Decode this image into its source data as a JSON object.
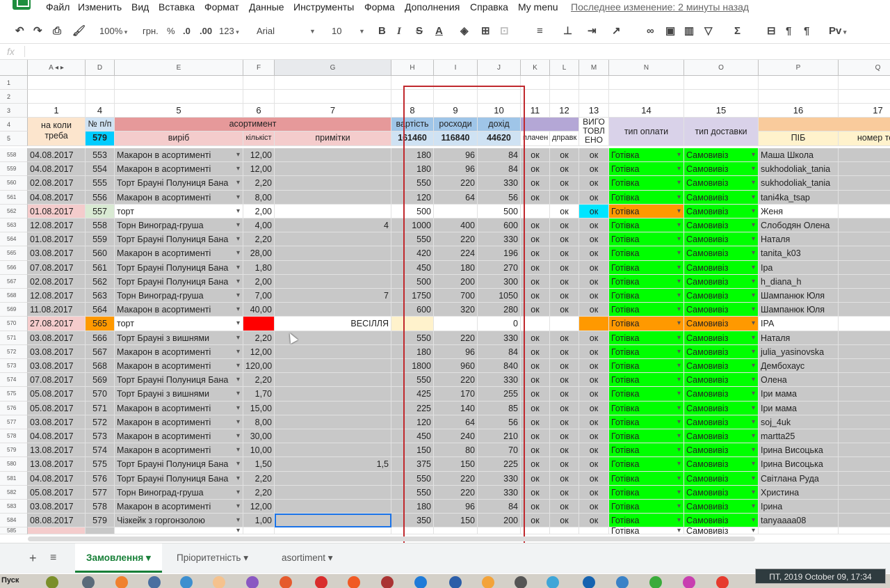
{
  "menu": {
    "items": [
      "Файл",
      "Изменить",
      "Вид",
      "Вставка",
      "Формат",
      "Данные",
      "Инструменты",
      "Форма",
      "Дополнения",
      "Справка",
      "My menu"
    ],
    "last_edit": "Последнее изменение: 2 минуты назад"
  },
  "toolbar": {
    "zoom": "100%",
    "currency": "грн.",
    "percent": "%",
    "dec_less": ".0",
    "dec_more": ".00",
    "format": "123",
    "font": "Arial",
    "size": "10",
    "bold": "B",
    "italic": "I",
    "strike": "S",
    "textcolor": "A",
    "fx": "fx",
    "cyr": "Рv"
  },
  "columns": [
    {
      "id": "A",
      "w": 83
    },
    {
      "id": "D",
      "w": 42
    },
    {
      "id": "E",
      "w": 185
    },
    {
      "id": "F",
      "w": 45
    },
    {
      "id": "G",
      "w": 168
    },
    {
      "id": "H",
      "w": 61
    },
    {
      "id": "I",
      "w": 63
    },
    {
      "id": "J",
      "w": 62
    },
    {
      "id": "K",
      "w": 42
    },
    {
      "id": "L",
      "w": 42
    },
    {
      "id": "M",
      "w": 43
    },
    {
      "id": "N",
      "w": 108
    },
    {
      "id": "O",
      "w": 107
    },
    {
      "id": "P",
      "w": 115
    },
    {
      "id": "Q",
      "w": 114
    }
  ],
  "row_numbers": [
    "1",
    "4",
    "5",
    "6",
    "7",
    "8",
    "9",
    "10",
    "11",
    "12",
    "13",
    "14",
    "15",
    "16",
    "17"
  ],
  "header4": {
    "a": "на коли",
    "a2": "треба",
    "d": "№ п/п",
    "assort": "асортимент",
    "h": "вартість",
    "i": "росходи",
    "j": "дохід",
    "m": "ВИГО",
    "m2": "ТОВЛ",
    "m3": "ЕНО",
    "n": "тип оплати",
    "o": "тип доставки"
  },
  "header5": {
    "d": "579",
    "e": "виріб",
    "f": "кількіст",
    "g": "примітки",
    "h": "161460",
    "i": "116840",
    "j": "44620",
    "k": "плачен",
    "l": "дправк",
    "p": "ПІБ",
    "q": "номер тел"
  },
  "rows": [
    {
      "n": "558",
      "a": "04.08.2017",
      "d": "553",
      "e": "Макарон в асортименті",
      "f": "12,00",
      "g": "",
      "h": "180",
      "i": "96",
      "j": "84",
      "k": "ок",
      "l": "ок",
      "m": "ок",
      "pay": "Готівка",
      "del": "Самовивіз",
      "p": "Маша Школа"
    },
    {
      "n": "559",
      "a": "04.08.2017",
      "d": "554",
      "e": "Макарон в асортименті",
      "f": "12,00",
      "g": "",
      "h": "180",
      "i": "96",
      "j": "84",
      "k": "ок",
      "l": "ок",
      "m": "ок",
      "pay": "Готівка",
      "del": "Самовивіз",
      "p": "sukhodoliak_tania"
    },
    {
      "n": "560",
      "a": "02.08.2017",
      "d": "555",
      "e": "Торт Брауні Полуниця Бана",
      "f": "2,20",
      "g": "",
      "h": "550",
      "i": "220",
      "j": "330",
      "k": "ок",
      "l": "ок",
      "m": "ок",
      "pay": "Готівка",
      "del": "Самовивіз",
      "p": "sukhodoliak_tania"
    },
    {
      "n": "561",
      "a": "04.08.2017",
      "d": "556",
      "e": "Макарон в асортименті",
      "f": "8,00",
      "g": "",
      "h": "120",
      "i": "64",
      "j": "56",
      "k": "ок",
      "l": "ок",
      "m": "ок",
      "pay": "Готівка",
      "del": "Самовивіз",
      "p": "tani4ka_tsap"
    },
    {
      "n": "562",
      "a": "01.08.2017",
      "d": "557",
      "e": "торт",
      "f": "2,00",
      "g": "",
      "h": "500",
      "i": "",
      "j": "500",
      "k": "",
      "l": "ок",
      "m": "ок",
      "pay": "Готівка",
      "del": "Самовивіз",
      "p": "Женя",
      "special": "pink"
    },
    {
      "n": "563",
      "a": "12.08.2017",
      "d": "558",
      "e": "Торн Виноград-груша",
      "f": "4,00",
      "g": "4",
      "h": "1000",
      "i": "400",
      "j": "600",
      "k": "ок",
      "l": "ок",
      "m": "ок",
      "pay": "Готівка",
      "del": "Самовивіз",
      "p": "Слободян Олена"
    },
    {
      "n": "564",
      "a": "01.08.2017",
      "d": "559",
      "e": "Торт Брауні Полуниця Бана",
      "f": "2,20",
      "g": "",
      "h": "550",
      "i": "220",
      "j": "330",
      "k": "ок",
      "l": "ок",
      "m": "ок",
      "pay": "Готівка",
      "del": "Самовивіз",
      "p": "Наталя"
    },
    {
      "n": "565",
      "a": "03.08.2017",
      "d": "560",
      "e": "Макарон в асортименті",
      "f": "28,00",
      "g": "",
      "h": "420",
      "i": "224",
      "j": "196",
      "k": "ок",
      "l": "ок",
      "m": "ок",
      "pay": "Готівка",
      "del": "Самовивіз",
      "p": "tanita_k03"
    },
    {
      "n": "566",
      "a": "07.08.2017",
      "d": "561",
      "e": "Торт Брауні Полуниця Бана",
      "f": "1,80",
      "g": "",
      "h": "450",
      "i": "180",
      "j": "270",
      "k": "ок",
      "l": "ок",
      "m": "ок",
      "pay": "Готівка",
      "del": "Самовивіз",
      "p": "Іра"
    },
    {
      "n": "567",
      "a": "02.08.2017",
      "d": "562",
      "e": "Торт Брауні Полуниця Бана",
      "f": "2,00",
      "g": "",
      "h": "500",
      "i": "200",
      "j": "300",
      "k": "ок",
      "l": "ок",
      "m": "ок",
      "pay": "Готівка",
      "del": "Самовивіз",
      "p": "h_diana_h"
    },
    {
      "n": "568",
      "a": "12.08.2017",
      "d": "563",
      "e": "Торн Виноград-груша",
      "f": "7,00",
      "g": "7",
      "h": "1750",
      "i": "700",
      "j": "1050",
      "k": "ок",
      "l": "ок",
      "m": "ок",
      "pay": "Готівка",
      "del": "Самовивіз",
      "p": "Шампанюк Юля"
    },
    {
      "n": "569",
      "a": "11.08.2017",
      "d": "564",
      "e": "Макарон в асортименті",
      "f": "40,00",
      "g": "",
      "h": "600",
      "i": "320",
      "j": "280",
      "k": "ок",
      "l": "ок",
      "m": "ок",
      "pay": "Готівка",
      "del": "Самовивіз",
      "p": "Шампанюк Юля"
    },
    {
      "n": "570",
      "a": "27.08.2017",
      "d": "565",
      "e": "торт",
      "f": "",
      "g": "ВЕСІЛЛЯ",
      "h": "",
      "i": "",
      "j": "0",
      "k": "",
      "l": "",
      "m": "",
      "pay": "Готівка",
      "del": "Самовивіз",
      "p": "ІРА",
      "special": "orange"
    },
    {
      "n": "571",
      "a": "03.08.2017",
      "d": "566",
      "e": "Торт Брауні з вишнями",
      "f": "2,20",
      "g": "",
      "h": "550",
      "i": "220",
      "j": "330",
      "k": "ок",
      "l": "ок",
      "m": "ок",
      "pay": "Готівка",
      "del": "Самовивіз",
      "p": "Наталя"
    },
    {
      "n": "572",
      "a": "03.08.2017",
      "d": "567",
      "e": "Макарон в асортименті",
      "f": "12,00",
      "g": "",
      "h": "180",
      "i": "96",
      "j": "84",
      "k": "ок",
      "l": "ок",
      "m": "ок",
      "pay": "Готівка",
      "del": "Самовивіз",
      "p": "julia_yasinovska"
    },
    {
      "n": "573",
      "a": "03.08.2017",
      "d": "568",
      "e": "Макарон в асортименті",
      "f": "120,00",
      "g": "",
      "h": "1800",
      "i": "960",
      "j": "840",
      "k": "ок",
      "l": "ок",
      "m": "ок",
      "pay": "Готівка",
      "del": "Самовивіз",
      "p": "Дембохаус"
    },
    {
      "n": "574",
      "a": "07.08.2017",
      "d": "569",
      "e": "Торт Брауні Полуниця Бана",
      "f": "2,20",
      "g": "",
      "h": "550",
      "i": "220",
      "j": "330",
      "k": "ок",
      "l": "ок",
      "m": "ок",
      "pay": "Готівка",
      "del": "Самовивіз",
      "p": "Олена"
    },
    {
      "n": "575",
      "a": "05.08.2017",
      "d": "570",
      "e": "Торт Брауні з вишнями",
      "f": "1,70",
      "g": "",
      "h": "425",
      "i": "170",
      "j": "255",
      "k": "ок",
      "l": "ок",
      "m": "ок",
      "pay": "Готівка",
      "del": "Самовивіз",
      "p": "Іри мама"
    },
    {
      "n": "576",
      "a": "05.08.2017",
      "d": "571",
      "e": "Макарон в асортименті",
      "f": "15,00",
      "g": "",
      "h": "225",
      "i": "140",
      "j": "85",
      "k": "ок",
      "l": "ок",
      "m": "ок",
      "pay": "Готівка",
      "del": "Самовивіз",
      "p": "Іри мама"
    },
    {
      "n": "577",
      "a": "03.08.2017",
      "d": "572",
      "e": "Макарон в асортименті",
      "f": "8,00",
      "g": "",
      "h": "120",
      "i": "64",
      "j": "56",
      "k": "ок",
      "l": "ок",
      "m": "ок",
      "pay": "Готівка",
      "del": "Самовивіз",
      "p": "soj_4uk"
    },
    {
      "n": "578",
      "a": "04.08.2017",
      "d": "573",
      "e": "Макарон в асортименті",
      "f": "30,00",
      "g": "",
      "h": "450",
      "i": "240",
      "j": "210",
      "k": "ок",
      "l": "ок",
      "m": "ок",
      "pay": "Готівка",
      "del": "Самовивіз",
      "p": " martta25"
    },
    {
      "n": "579",
      "a": "13.08.2017",
      "d": "574",
      "e": "Макарон в асортименті",
      "f": "10,00",
      "g": "",
      "h": "150",
      "i": "80",
      "j": "70",
      "k": "ок",
      "l": "ок",
      "m": "ок",
      "pay": "Готівка",
      "del": "Самовивіз",
      "p": "Ірина Висоцька"
    },
    {
      "n": "580",
      "a": "13.08.2017",
      "d": "575",
      "e": "Торт Брауні Полуниця Бана",
      "f": "1,50",
      "g": "1,5",
      "h": "375",
      "i": "150",
      "j": "225",
      "k": "ок",
      "l": "ок",
      "m": "ок",
      "pay": "Готівка",
      "del": "Самовивіз",
      "p": "Ірина Висоцька"
    },
    {
      "n": "581",
      "a": "04.08.2017",
      "d": "576",
      "e": "Торт Брауні Полуниця Бана",
      "f": "2,20",
      "g": "",
      "h": "550",
      "i": "220",
      "j": "330",
      "k": "ок",
      "l": "ок",
      "m": "ок",
      "pay": "Готівка",
      "del": "Самовивіз",
      "p": "Світлана Руда"
    },
    {
      "n": "582",
      "a": "05.08.2017",
      "d": "577",
      "e": "Торн Виноград-груша",
      "f": "2,20",
      "g": "",
      "h": "550",
      "i": "220",
      "j": "330",
      "k": "ок",
      "l": "ок",
      "m": "ок",
      "pay": "Готівка",
      "del": "Самовивіз",
      "p": "Христина"
    },
    {
      "n": "583",
      "a": "03.08.2017",
      "d": "578",
      "e": "Макарон в асортименті",
      "f": "12,00",
      "g": "",
      "h": "180",
      "i": "96",
      "j": "84",
      "k": "ок",
      "l": "ок",
      "m": "ок",
      "pay": "Готівка",
      "del": "Самовивіз",
      "p": "Ірина"
    },
    {
      "n": "584",
      "a": "08.08.2017",
      "d": "579",
      "e": "Чізкейк з горгонзолою",
      "f": "1,00",
      "g": "",
      "h": "350",
      "i": "150",
      "j": "200",
      "k": "ок",
      "l": "ок",
      "m": "ок",
      "pay": "Готівка",
      "del": "Самовивіз",
      "p": "tanyaaaa08"
    },
    {
      "n": "585",
      "a": "",
      "d": "",
      "e": "",
      "f": "",
      "g": "",
      "h": "",
      "i": "",
      "j": "",
      "k": "",
      "l": "",
      "m": "",
      "pay": "Готівка",
      "del": "Самовивіз",
      "p": ""
    }
  ],
  "sheets": [
    "Замовлення",
    "Пріоритетність",
    "asortiment"
  ],
  "taskbar": {
    "start": "Пуск",
    "clock": "ПТ, 2019 October 09, 17:34"
  },
  "colors": {
    "gray": "#c8c8c8",
    "green": "#00ff00",
    "pink": "#f4cccc",
    "header_red": "#e6999a",
    "header_blue": "#9fc5e8",
    "header_purple": "#b4a7d6",
    "header_orange": "#f9cb9c",
    "cyan": "#00e5ff",
    "orange": "#ff9900",
    "red": "#ff0000"
  }
}
